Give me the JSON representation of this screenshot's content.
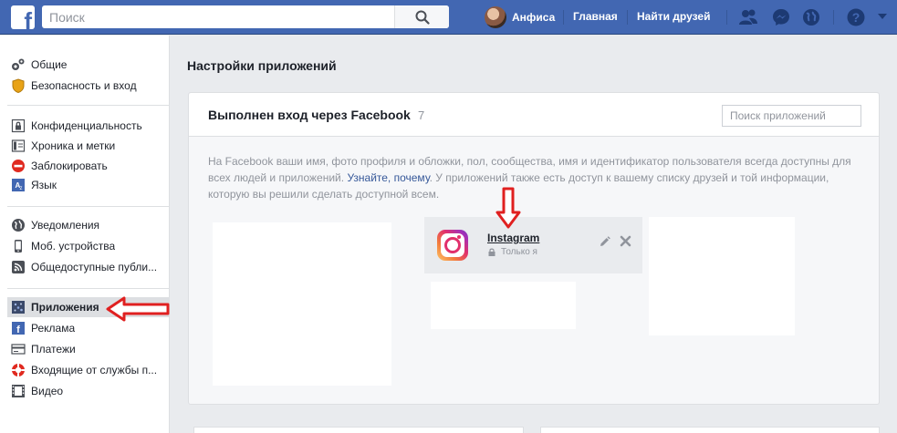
{
  "topbar": {
    "search_placeholder": "Поиск",
    "user_name": "Анфиса",
    "home_label": "Главная",
    "find_friends_label": "Найти друзей"
  },
  "sidebar": {
    "groups": [
      [
        {
          "label": "Общие",
          "icon": "gears-icon"
        },
        {
          "label": "Безопасность и вход",
          "icon": "shield-icon"
        }
      ],
      [
        {
          "label": "Конфиденциальность",
          "icon": "lock-icon"
        },
        {
          "label": "Хроника и метки",
          "icon": "timeline-icon"
        },
        {
          "label": "Заблокировать",
          "icon": "block-icon"
        },
        {
          "label": "Язык",
          "icon": "language-icon"
        }
      ],
      [
        {
          "label": "Уведомления",
          "icon": "globe-icon"
        },
        {
          "label": "Моб. устройства",
          "icon": "mobile-icon"
        },
        {
          "label": "Общедоступные публи...",
          "icon": "rss-icon"
        }
      ],
      [
        {
          "label": "Приложения",
          "icon": "apps-icon",
          "active": true
        },
        {
          "label": "Реклама",
          "icon": "ads-icon"
        },
        {
          "label": "Платежи",
          "icon": "payments-icon"
        },
        {
          "label": "Входящие от службы п...",
          "icon": "support-icon"
        },
        {
          "label": "Видео",
          "icon": "video-icon"
        }
      ]
    ]
  },
  "main": {
    "page_title": "Настройки приложений",
    "panel_title": "Выполнен вход через Facebook",
    "app_count": "7",
    "app_search_placeholder": "Поиск приложений",
    "info_before_link": "На Facebook ваши имя, фото профиля и обложки, пол, сообщества, имя и идентификатор пользователя всегда доступны для всех людей и приложений. ",
    "info_link": "Узнайте, почему",
    "info_after_link": ". У приложений также есть доступ к вашему списку друзей и той информации, которую вы решили сделать доступной всем.",
    "app": {
      "name": "Instagram",
      "privacy": "Только я"
    }
  },
  "colors": {
    "brand_blue": "#4267b2",
    "annotation_red": "#e02020"
  }
}
